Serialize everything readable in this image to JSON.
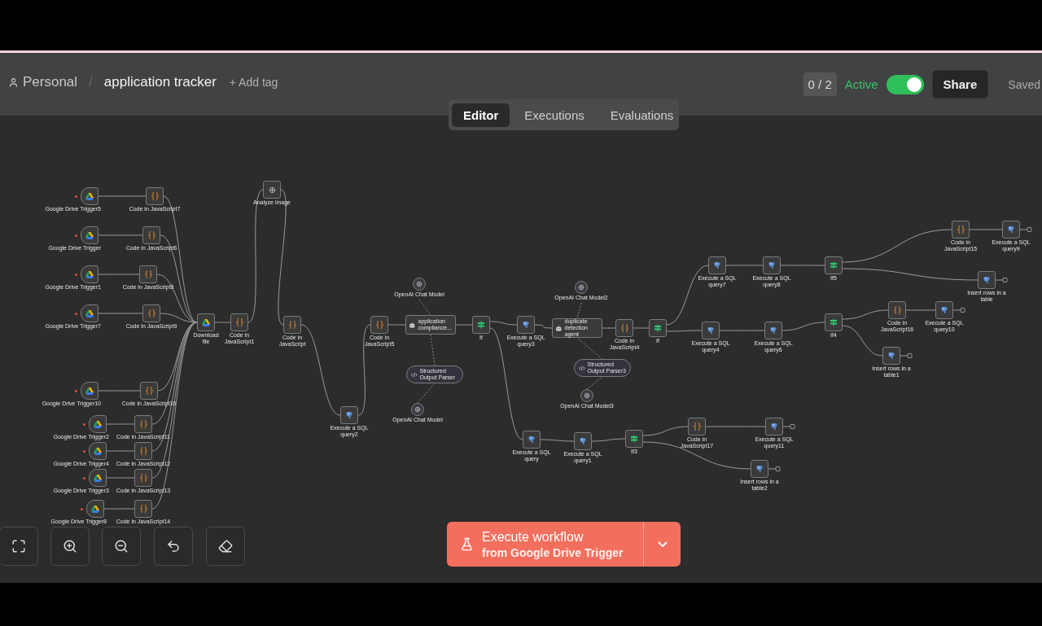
{
  "breadcrumb": {
    "project": "Personal",
    "separator": "/",
    "workflow": "application tracker"
  },
  "add_tag": "+ Add tag",
  "counter": "0 / 2",
  "active": {
    "label": "Active",
    "on": true
  },
  "share": "Share",
  "save_status": "Saved",
  "tabs": [
    {
      "label": "Editor",
      "selected": true
    },
    {
      "label": "Executions",
      "selected": false
    },
    {
      "label": "Evaluations",
      "selected": false
    }
  ],
  "nodes": [
    {
      "kind": "trigger",
      "label": "Google Drive Trigger5"
    },
    {
      "kind": "code",
      "label": "Code in JavaScript7"
    },
    {
      "kind": "trigger",
      "label": "Google Drive Trigger"
    },
    {
      "kind": "code",
      "label": "Code in JavaScript6"
    },
    {
      "kind": "trigger",
      "label": "Google Drive Trigger1"
    },
    {
      "kind": "code",
      "label": "Code in JavaScript8"
    },
    {
      "kind": "trigger",
      "label": "Google Drive Trigger7"
    },
    {
      "kind": "code",
      "label": "Code in JavaScript9"
    },
    {
      "kind": "trigger",
      "label": "Google Drive Trigger10"
    },
    {
      "kind": "code",
      "label": "Code in JavaScript10"
    },
    {
      "kind": "trigger",
      "label": "Google Drive Trigger2"
    },
    {
      "kind": "code",
      "label": "Code in JavaScript11"
    },
    {
      "kind": "trigger",
      "label": "Google Drive Trigger4"
    },
    {
      "kind": "code",
      "label": "Code in JavaScript12"
    },
    {
      "kind": "trigger",
      "label": "Google Drive Trigger3"
    },
    {
      "kind": "code",
      "label": "Code in JavaScript13"
    },
    {
      "kind": "trigger",
      "label": "Google Drive Trigger8"
    },
    {
      "kind": "code",
      "label": "Code in JavaScript14"
    },
    {
      "kind": "drive",
      "label": "Download file"
    },
    {
      "kind": "code",
      "label": "Code in JavaScript1"
    },
    {
      "kind": "image",
      "label": "Analyze image"
    },
    {
      "kind": "code",
      "label": "Code in JavaScript"
    },
    {
      "kind": "sql",
      "label": "Execute a SQL query2"
    },
    {
      "kind": "code",
      "label": "Code in JavaScript5"
    },
    {
      "kind": "model",
      "label": "OpenAI Chat Model"
    },
    {
      "kind": "agent",
      "label": "application compliance..."
    },
    {
      "kind": "parser",
      "label": "Structured Output Parser"
    },
    {
      "kind": "model",
      "label": "OpenAI Chat Model"
    },
    {
      "kind": "if",
      "label": "If"
    },
    {
      "kind": "sql",
      "label": "Execute a SQL query3"
    },
    {
      "kind": "model",
      "label": "OpenAI Chat Model2"
    },
    {
      "kind": "agent",
      "label": "duplicate detection agent"
    },
    {
      "kind": "parser",
      "label": "Structured Output Parser3"
    },
    {
      "kind": "model",
      "label": "OpenAI Chat Model3"
    },
    {
      "kind": "code",
      "label": "Code in JavaScript4"
    },
    {
      "kind": "if",
      "label": "If"
    },
    {
      "kind": "sql",
      "label": "Execute a SQL query7"
    },
    {
      "kind": "sql",
      "label": "Execute a SQL query8"
    },
    {
      "kind": "if",
      "label": "If5"
    },
    {
      "kind": "code",
      "label": "Code in JavaScript15"
    },
    {
      "kind": "sql",
      "label": "Execute a SQL query9"
    },
    {
      "kind": "sql",
      "label": "Insert rows in a table"
    },
    {
      "kind": "sql",
      "label": "Execute a SQL query4"
    },
    {
      "kind": "sql",
      "label": "Execute a SQL query6"
    },
    {
      "kind": "if",
      "label": "If4"
    },
    {
      "kind": "code",
      "label": "Code in JavaScript16"
    },
    {
      "kind": "sql",
      "label": "Execute a SQL query10"
    },
    {
      "kind": "sql",
      "label": "Insert rows in a table1"
    },
    {
      "kind": "sql",
      "label": "Execute a SQL query"
    },
    {
      "kind": "sql",
      "label": "Execute a SQL query1"
    },
    {
      "kind": "if",
      "label": "If3"
    },
    {
      "kind": "code",
      "label": "Code in JavaScript17"
    },
    {
      "kind": "sql",
      "label": "Execute a SQL query11"
    },
    {
      "kind": "sql",
      "label": "Insert rows in a table2"
    }
  ],
  "execute": {
    "title": "Execute workflow",
    "subtitle": "from Google Drive Trigger"
  }
}
